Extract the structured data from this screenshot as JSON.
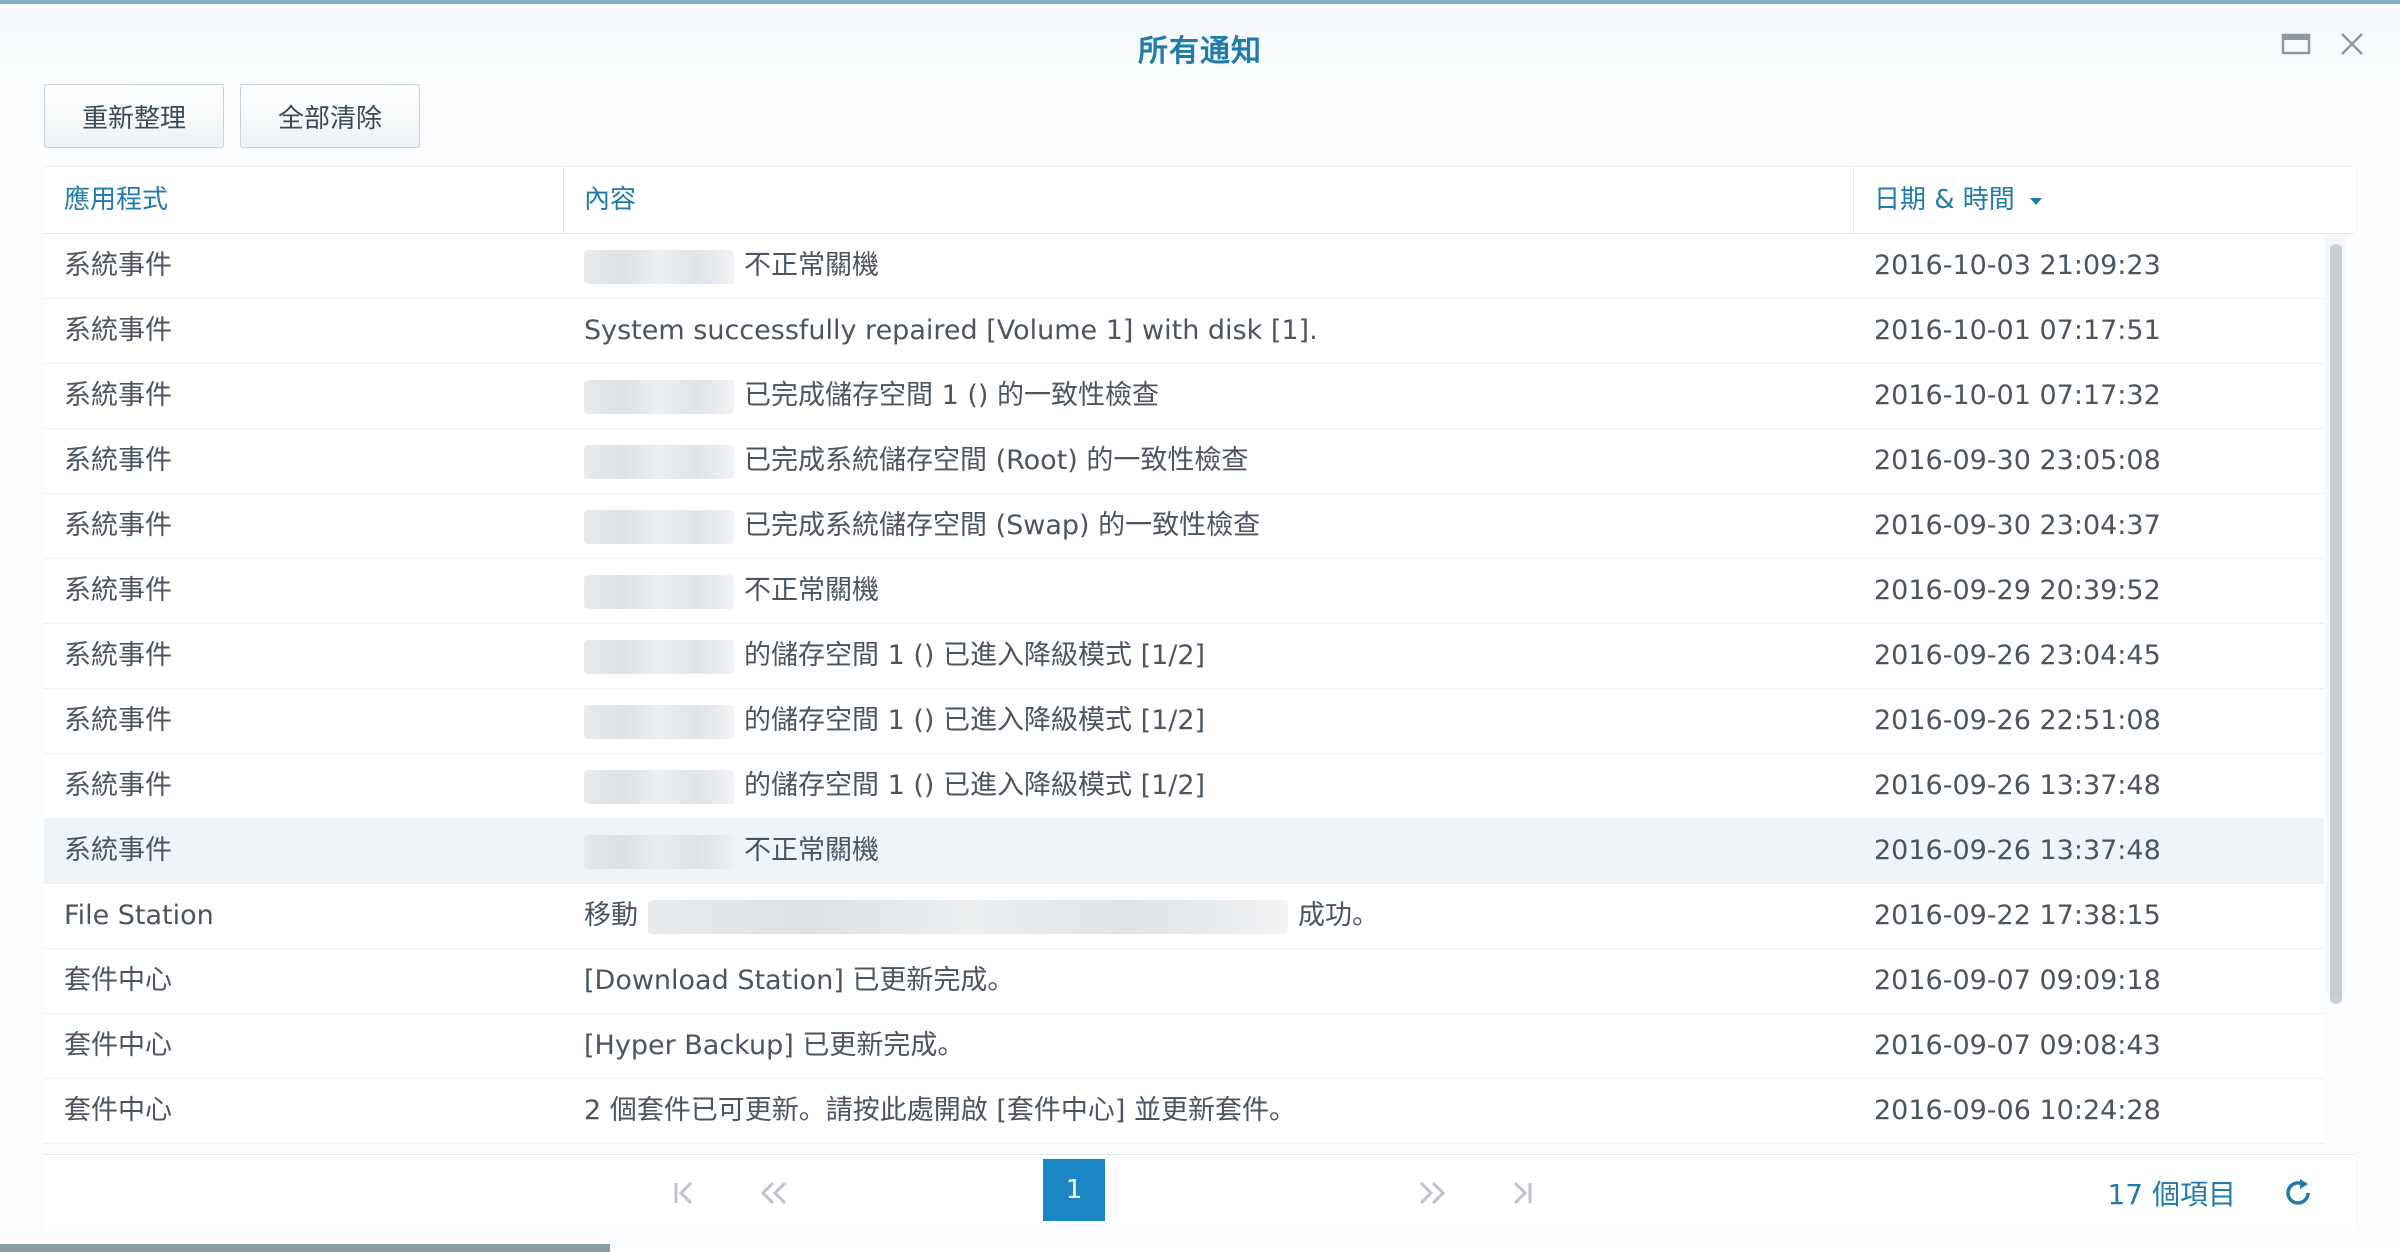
{
  "window": {
    "title": "所有通知"
  },
  "toolbar": {
    "refresh_label": "重新整理",
    "clear_all_label": "全部清除"
  },
  "columns": {
    "app": "應用程式",
    "content": "內容",
    "datetime": "日期 & 時間"
  },
  "rows": [
    {
      "app": "系統事件",
      "content": "不正常關機",
      "datetime": "2016-10-03 21:09:23",
      "redacted": true
    },
    {
      "app": "系統事件",
      "content": "System successfully repaired [Volume 1] with disk [1].",
      "datetime": "2016-10-01 07:17:51",
      "redacted": false
    },
    {
      "app": "系統事件",
      "content": "已完成儲存空間 1 () 的一致性檢查",
      "datetime": "2016-10-01 07:17:32",
      "redacted": true
    },
    {
      "app": "系統事件",
      "content": "已完成系統儲存空間 (Root) 的一致性檢查",
      "datetime": "2016-09-30 23:05:08",
      "redacted": true
    },
    {
      "app": "系統事件",
      "content": "已完成系統儲存空間 (Swap) 的一致性檢查",
      "datetime": "2016-09-30 23:04:37",
      "redacted": true
    },
    {
      "app": "系統事件",
      "content": "不正常關機",
      "datetime": "2016-09-29 20:39:52",
      "redacted": true
    },
    {
      "app": "系統事件",
      "content": "的儲存空間 1 () 已進入降級模式 [1/2]",
      "datetime": "2016-09-26 23:04:45",
      "redacted": true
    },
    {
      "app": "系統事件",
      "content": "的儲存空間 1 () 已進入降級模式 [1/2]",
      "datetime": "2016-09-26 22:51:08",
      "redacted": true
    },
    {
      "app": "系統事件",
      "content": "的儲存空間 1 () 已進入降級模式 [1/2]",
      "datetime": "2016-09-26 13:37:48",
      "redacted": true
    },
    {
      "app": "系統事件",
      "content": "不正常關機",
      "datetime": "2016-09-26 13:37:48",
      "redacted": true,
      "selected": true
    },
    {
      "app": "File Station",
      "content_prefix": "移動",
      "content": "成功。",
      "datetime": "2016-09-22 17:38:15",
      "redacted": "middle"
    },
    {
      "app": "套件中心",
      "content": "[Download Station] 已更新完成。",
      "datetime": "2016-09-07 09:09:18",
      "redacted": false
    },
    {
      "app": "套件中心",
      "content": "[Hyper Backup] 已更新完成。",
      "datetime": "2016-09-07 09:08:43",
      "redacted": false
    },
    {
      "app": "套件中心",
      "content": "2 個套件已可更新。請按此處開啟 [套件中心] 並更新套件。",
      "datetime": "2016-09-06 10:24:28",
      "redacted": false
    }
  ],
  "pager": {
    "current_page": "1",
    "item_count": "17 個項目"
  },
  "icons": {
    "maximize": "maximize-icon",
    "close": "close-icon",
    "sort": "sort-desc-icon",
    "first": "first-page-icon",
    "prev": "prev-page-icon",
    "next": "next-page-icon",
    "last": "last-page-icon",
    "refresh": "refresh-icon"
  },
  "colors": {
    "accent": "#1e7bab",
    "page_active": "#1a86c4",
    "selected_row": "#eef4f8"
  }
}
